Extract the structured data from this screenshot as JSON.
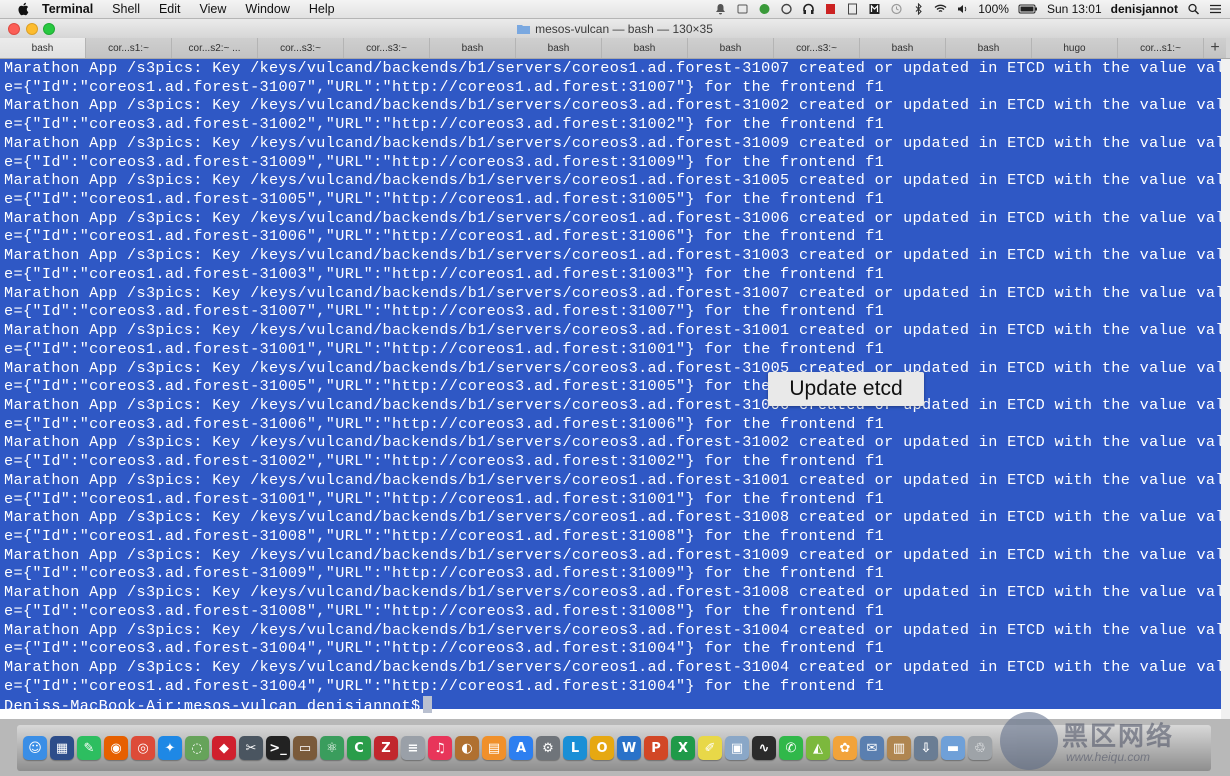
{
  "menubar": {
    "app_name": "Terminal",
    "items": [
      "Shell",
      "Edit",
      "View",
      "Window",
      "Help"
    ],
    "battery": "100%",
    "clock": "Sun 13:01",
    "user": "denisjannot"
  },
  "window": {
    "title": "mesos-vulcan — bash — 130×35"
  },
  "tabs": [
    {
      "label": "bash",
      "active": true
    },
    {
      "label": "cor...s1:~"
    },
    {
      "label": "cor...s2:~ ..."
    },
    {
      "label": "cor...s3:~"
    },
    {
      "label": "cor...s3:~"
    },
    {
      "label": "bash"
    },
    {
      "label": "bash"
    },
    {
      "label": "bash"
    },
    {
      "label": "bash"
    },
    {
      "label": "cor...s3:~"
    },
    {
      "label": "bash"
    },
    {
      "label": "bash"
    },
    {
      "label": "hugo"
    },
    {
      "label": "cor...s1:~"
    }
  ],
  "tab_add_label": "+",
  "terminal": {
    "lines": [
      "Marathon App /s3pics: Key /keys/vulcand/backends/b1/servers/coreos1.ad.forest-31007 created or updated in ETCD with the value valu",
      "e={\"Id\":\"coreos1.ad.forest-31007\",\"URL\":\"http://coreos1.ad.forest:31007\"} for the frontend f1",
      "Marathon App /s3pics: Key /keys/vulcand/backends/b1/servers/coreos3.ad.forest-31002 created or updated in ETCD with the value valu",
      "e={\"Id\":\"coreos3.ad.forest-31002\",\"URL\":\"http://coreos3.ad.forest:31002\"} for the frontend f1",
      "Marathon App /s3pics: Key /keys/vulcand/backends/b1/servers/coreos3.ad.forest-31009 created or updated in ETCD with the value valu",
      "e={\"Id\":\"coreos3.ad.forest-31009\",\"URL\":\"http://coreos3.ad.forest:31009\"} for the frontend f1",
      "Marathon App /s3pics: Key /keys/vulcand/backends/b1/servers/coreos1.ad.forest-31005 created or updated in ETCD with the value valu",
      "e={\"Id\":\"coreos1.ad.forest-31005\",\"URL\":\"http://coreos1.ad.forest:31005\"} for the frontend f1",
      "Marathon App /s3pics: Key /keys/vulcand/backends/b1/servers/coreos1.ad.forest-31006 created or updated in ETCD with the value valu",
      "e={\"Id\":\"coreos1.ad.forest-31006\",\"URL\":\"http://coreos1.ad.forest:31006\"} for the frontend f1",
      "Marathon App /s3pics: Key /keys/vulcand/backends/b1/servers/coreos1.ad.forest-31003 created or updated in ETCD with the value valu",
      "e={\"Id\":\"coreos1.ad.forest-31003\",\"URL\":\"http://coreos1.ad.forest:31003\"} for the frontend f1",
      "Marathon App /s3pics: Key /keys/vulcand/backends/b1/servers/coreos3.ad.forest-31007 created or updated in ETCD with the value valu",
      "e={\"Id\":\"coreos3.ad.forest-31007\",\"URL\":\"http://coreos3.ad.forest:31007\"} for the frontend f1",
      "Marathon App /s3pics: Key /keys/vulcand/backends/b1/servers/coreos3.ad.forest-31001 created or updated in ETCD with the value valu",
      "e={\"Id\":\"coreos1.ad.forest-31001\",\"URL\":\"http://coreos1.ad.forest:31001\"} for the frontend f1",
      "Marathon App /s3pics: Key /keys/vulcand/backends/b1/servers/coreos3.ad.forest-31005 created or updated in ETCD with the value valu",
      "e={\"Id\":\"coreos3.ad.forest-31005\",\"URL\":\"http://coreos3.ad.forest:31005\"} for the frontend f1",
      "Marathon App /s3pics: Key /keys/vulcand/backends/b1/servers/coreos3.ad.forest-31006 created or updated in ETCD with the value valu",
      "e={\"Id\":\"coreos3.ad.forest-31006\",\"URL\":\"http://coreos3.ad.forest:31006\"} for the frontend f1",
      "Marathon App /s3pics: Key /keys/vulcand/backends/b1/servers/coreos3.ad.forest-31002 created or updated in ETCD with the value valu",
      "e={\"Id\":\"coreos3.ad.forest-31002\",\"URL\":\"http://coreos3.ad.forest:31002\"} for the frontend f1",
      "Marathon App /s3pics: Key /keys/vulcand/backends/b1/servers/coreos1.ad.forest-31001 created or updated in ETCD with the value valu",
      "e={\"Id\":\"coreos1.ad.forest-31001\",\"URL\":\"http://coreos1.ad.forest:31001\"} for the frontend f1",
      "Marathon App /s3pics: Key /keys/vulcand/backends/b1/servers/coreos1.ad.forest-31008 created or updated in ETCD with the value valu",
      "e={\"Id\":\"coreos1.ad.forest-31008\",\"URL\":\"http://coreos1.ad.forest:31008\"} for the frontend f1",
      "Marathon App /s3pics: Key /keys/vulcand/backends/b1/servers/coreos3.ad.forest-31009 created or updated in ETCD with the value valu",
      "e={\"Id\":\"coreos3.ad.forest-31009\",\"URL\":\"http://coreos3.ad.forest:31009\"} for the frontend f1",
      "Marathon App /s3pics: Key /keys/vulcand/backends/b1/servers/coreos3.ad.forest-31008 created or updated in ETCD with the value valu",
      "e={\"Id\":\"coreos3.ad.forest-31008\",\"URL\":\"http://coreos3.ad.forest:31008\"} for the frontend f1",
      "Marathon App /s3pics: Key /keys/vulcand/backends/b1/servers/coreos3.ad.forest-31004 created or updated in ETCD with the value valu",
      "e={\"Id\":\"coreos3.ad.forest-31004\",\"URL\":\"http://coreos3.ad.forest:31004\"} for the frontend f1",
      "Marathon App /s3pics: Key /keys/vulcand/backends/b1/servers/coreos1.ad.forest-31004 created or updated in ETCD with the value valu",
      "e={\"Id\":\"coreos1.ad.forest-31004\",\"URL\":\"http://coreos1.ad.forest:31004\"} for the frontend f1"
    ],
    "prompt": "Deniss-MacBook-Air:mesos-vulcan denisjannot$"
  },
  "overlay": {
    "caption": "Update etcd"
  },
  "dock": {
    "icons": [
      {
        "name": "finder-icon",
        "glyph": "☺",
        "color": "#3a8ee6"
      },
      {
        "name": "dashboard-icon",
        "glyph": "▦",
        "color": "#2d4d8a"
      },
      {
        "name": "evernote-icon",
        "glyph": "✎",
        "color": "#2dbe60"
      },
      {
        "name": "firefox-icon",
        "glyph": "◉",
        "color": "#e66000"
      },
      {
        "name": "chrome-icon",
        "glyph": "◎",
        "color": "#dd4b39"
      },
      {
        "name": "safari-icon",
        "glyph": "✦",
        "color": "#1e88e5"
      },
      {
        "name": "network-icon",
        "glyph": "◌",
        "color": "#66a35a"
      },
      {
        "name": "keynote-icon",
        "glyph": "◆",
        "color": "#d0202e"
      },
      {
        "name": "screenshot-icon",
        "glyph": "✂",
        "color": "#4a5560"
      },
      {
        "name": "terminal-icon",
        "glyph": ">_",
        "color": "#222222"
      },
      {
        "name": "scanner-icon",
        "glyph": "▭",
        "color": "#7a5a3a"
      },
      {
        "name": "atom-icon",
        "glyph": "⚛",
        "color": "#3a9d5d"
      },
      {
        "name": "citrix-icon",
        "glyph": "C",
        "color": "#2a9d4a"
      },
      {
        "name": "filezilla-icon",
        "glyph": "Z",
        "color": "#c1272d"
      },
      {
        "name": "disk-icon",
        "glyph": "≡",
        "color": "#9aa0a8"
      },
      {
        "name": "itunes-icon",
        "glyph": "♫",
        "color": "#e8355a"
      },
      {
        "name": "audio-icon",
        "glyph": "◐",
        "color": "#b07030"
      },
      {
        "name": "ibooks-icon",
        "glyph": "▤",
        "color": "#f0902a"
      },
      {
        "name": "appstore-icon",
        "glyph": "A",
        "color": "#2d7ff0"
      },
      {
        "name": "system-prefs-icon",
        "glyph": "⚙",
        "color": "#6f747a"
      },
      {
        "name": "lync-icon",
        "glyph": "L",
        "color": "#1a8fd6"
      },
      {
        "name": "outlook-icon",
        "glyph": "O",
        "color": "#e6a812"
      },
      {
        "name": "word-icon",
        "glyph": "W",
        "color": "#2a72c9"
      },
      {
        "name": "powerpoint-icon",
        "glyph": "P",
        "color": "#d24726"
      },
      {
        "name": "excel-icon",
        "glyph": "X",
        "color": "#1f9a49"
      },
      {
        "name": "notes-icon",
        "glyph": "✐",
        "color": "#e8d848"
      },
      {
        "name": "preview-icon",
        "glyph": "▣",
        "color": "#8aa7c7"
      },
      {
        "name": "activity-monitor-icon",
        "glyph": "∿",
        "color": "#2b2b2b"
      },
      {
        "name": "messages-icon",
        "glyph": "✆",
        "color": "#30b84a"
      },
      {
        "name": "android-icon",
        "glyph": "◭",
        "color": "#7cb83d"
      },
      {
        "name": "photos-icon",
        "glyph": "✿",
        "color": "#f2a33a"
      },
      {
        "name": "mail-icon",
        "glyph": "✉",
        "color": "#5a7fb0"
      },
      {
        "name": "documents-icon",
        "glyph": "▥",
        "color": "#b08650"
      },
      {
        "name": "downloads-icon",
        "glyph": "⇩",
        "color": "#6a7d94"
      },
      {
        "name": "folder-icon",
        "glyph": "▬",
        "color": "#6fa0d8"
      },
      {
        "name": "trash-icon",
        "glyph": "♲",
        "color": "#9ea3a8"
      }
    ]
  },
  "watermark": {
    "text": "黑区网络",
    "url": "www.heiqu.com"
  }
}
